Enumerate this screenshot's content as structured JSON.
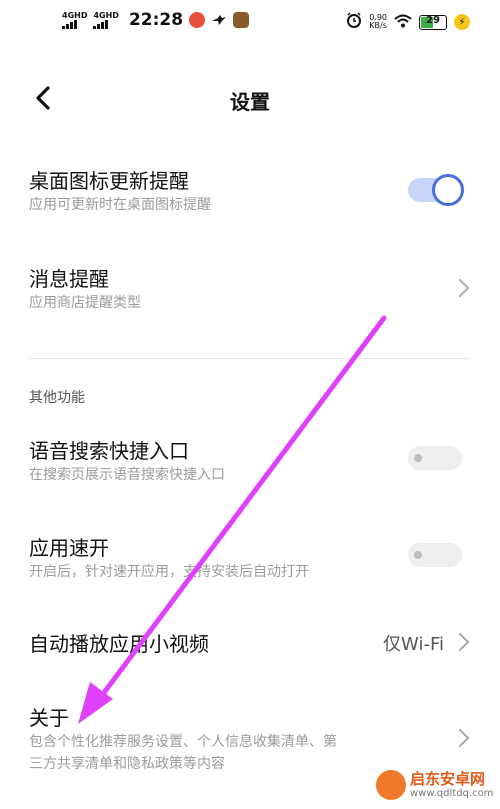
{
  "status_bar": {
    "signal1_label": "4GHD",
    "signal2_label": "4GHD",
    "time": "22:28",
    "net_speed_value": "0.90",
    "net_speed_unit": "KB/s",
    "battery_level": "29",
    "icons": [
      "signal-icon",
      "signal-icon",
      "app-notification-icon",
      "bird-icon",
      "game-app-icon",
      "alarm-icon",
      "wifi-icon",
      "battery-icon",
      "charging-icon"
    ]
  },
  "nav": {
    "title": "设置",
    "back_icon": "chevron-left-icon"
  },
  "settings": [
    {
      "title": "桌面图标更新提醒",
      "subtitle": "应用可更新时在桌面图标提醒",
      "control": "toggle",
      "state": "on"
    },
    {
      "title": "消息提醒",
      "subtitle": "应用商店提醒类型",
      "control": "chevron"
    },
    {
      "title": "语音搜索快捷入口",
      "subtitle": "在搜索页展示语音搜索快捷入口",
      "control": "toggle",
      "state": "off"
    },
    {
      "title": "应用速开",
      "subtitle": "开启后，针对速开应用，支持安装后自动打开",
      "control": "toggle",
      "state": "off"
    },
    {
      "title": "自动播放应用小视频",
      "value": "仅Wi-Fi",
      "control": "chevron"
    },
    {
      "title": "关于",
      "subtitle_line1": "包含个性化推荐服务设置、个人信息收集清单、第",
      "subtitle_line2": "三方共享清单和隐私政策等内容",
      "control": "chevron"
    }
  ],
  "section_header": "其他功能",
  "colors": {
    "toggle_on_track": "#c7d4f8",
    "toggle_on_knob": "#4a6ee0",
    "annotation_arrow": "#e040fb",
    "battery_fill": "#3cb043"
  },
  "watermark": {
    "line1": "启东安卓网",
    "line2": "www.qdltdq.com"
  }
}
